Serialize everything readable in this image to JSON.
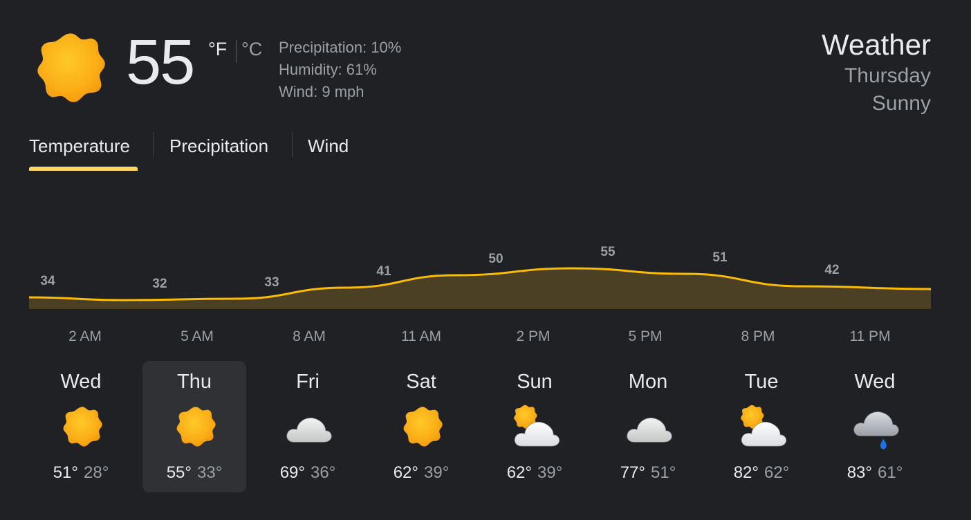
{
  "current": {
    "icon": "sun-icon",
    "temp": "55",
    "unit_f": "°F",
    "unit_c": "°C",
    "precipitation": "Precipitation: 10%",
    "humidity": "Humidity: 61%",
    "wind": "Wind: 9 mph"
  },
  "header": {
    "title": "Weather",
    "day": "Thursday",
    "condition": "Sunny"
  },
  "tabs": [
    {
      "label": "Temperature",
      "active": true
    },
    {
      "label": "Precipitation",
      "active": false
    },
    {
      "label": "Wind",
      "active": false
    }
  ],
  "colors": {
    "accent": "#fdd663",
    "line": "#fbbc04",
    "fill": "#4b4024",
    "background": "#202124",
    "selected_card": "#303134",
    "rain_drop": "#1a73e8"
  },
  "chart_data": {
    "type": "area",
    "x": [
      "2 AM",
      "5 AM",
      "8 AM",
      "11 AM",
      "2 PM",
      "5 PM",
      "8 PM",
      "11 PM"
    ],
    "values": [
      34,
      32,
      33,
      41,
      50,
      55,
      51,
      42
    ],
    "data_labels": [
      "34",
      "32",
      "33",
      "41",
      "50",
      "55",
      "51",
      "42"
    ]
  },
  "hour_labels": [
    "2 AM",
    "5 AM",
    "8 AM",
    "11 AM",
    "2 PM",
    "5 PM",
    "8 PM",
    "11 PM"
  ],
  "days": [
    {
      "name": "Wed",
      "icon": "sun-icon",
      "high": "51°",
      "low": "28°",
      "selected": false
    },
    {
      "name": "Thu",
      "icon": "sun-icon",
      "high": "55°",
      "low": "33°",
      "selected": true
    },
    {
      "name": "Fri",
      "icon": "cloud-icon",
      "high": "69°",
      "low": "36°",
      "selected": false
    },
    {
      "name": "Sat",
      "icon": "sun-icon",
      "high": "62°",
      "low": "39°",
      "selected": false
    },
    {
      "name": "Sun",
      "icon": "partly-cloudy-icon",
      "high": "62°",
      "low": "39°",
      "selected": false
    },
    {
      "name": "Mon",
      "icon": "cloud-icon",
      "high": "77°",
      "low": "51°",
      "selected": false
    },
    {
      "name": "Tue",
      "icon": "partly-cloudy-icon",
      "high": "82°",
      "low": "62°",
      "selected": false
    },
    {
      "name": "Wed",
      "icon": "rain-icon",
      "high": "83°",
      "low": "61°",
      "selected": false
    }
  ]
}
